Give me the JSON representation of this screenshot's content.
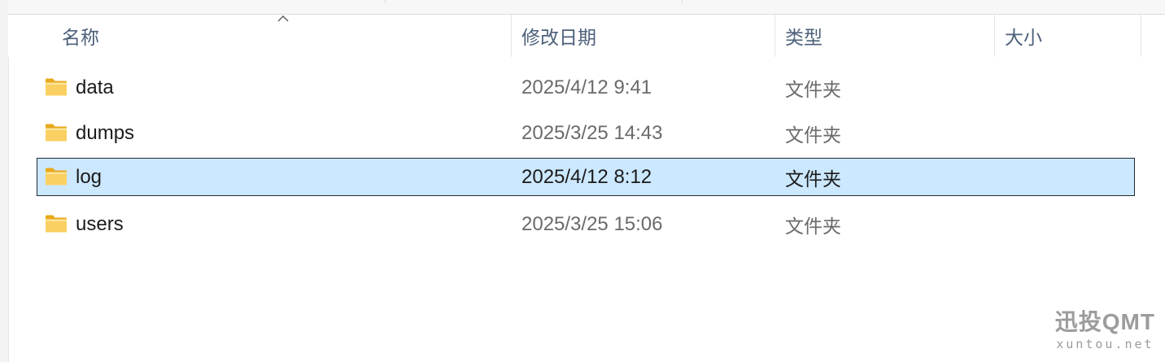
{
  "columns": {
    "name": "名称",
    "modified": "修改日期",
    "type": "类型",
    "size": "大小"
  },
  "rows": [
    {
      "name": "data",
      "modified": "2025/4/12 9:41",
      "type": "文件夹",
      "size": "",
      "selected": false,
      "icon": "folder-icon"
    },
    {
      "name": "dumps",
      "modified": "2025/3/25 14:43",
      "type": "文件夹",
      "size": "",
      "selected": false,
      "icon": "folder-icon"
    },
    {
      "name": "log",
      "modified": "2025/4/12 8:12",
      "type": "文件夹",
      "size": "",
      "selected": true,
      "icon": "folder-icon"
    },
    {
      "name": "users",
      "modified": "2025/3/25 15:06",
      "type": "文件夹",
      "size": "",
      "selected": false,
      "icon": "folder-icon"
    }
  ],
  "sort": {
    "column": "name",
    "direction": "ascending",
    "icon": "sort-up-chevron-icon"
  },
  "watermark": {
    "main": "迅投QMT",
    "sub": "xuntou.net"
  },
  "colors": {
    "selection_fill": "#cce8ff",
    "selection_border": "#1e2a36",
    "header_text": "#4c607a",
    "folder_yellow": "#f8c843"
  }
}
